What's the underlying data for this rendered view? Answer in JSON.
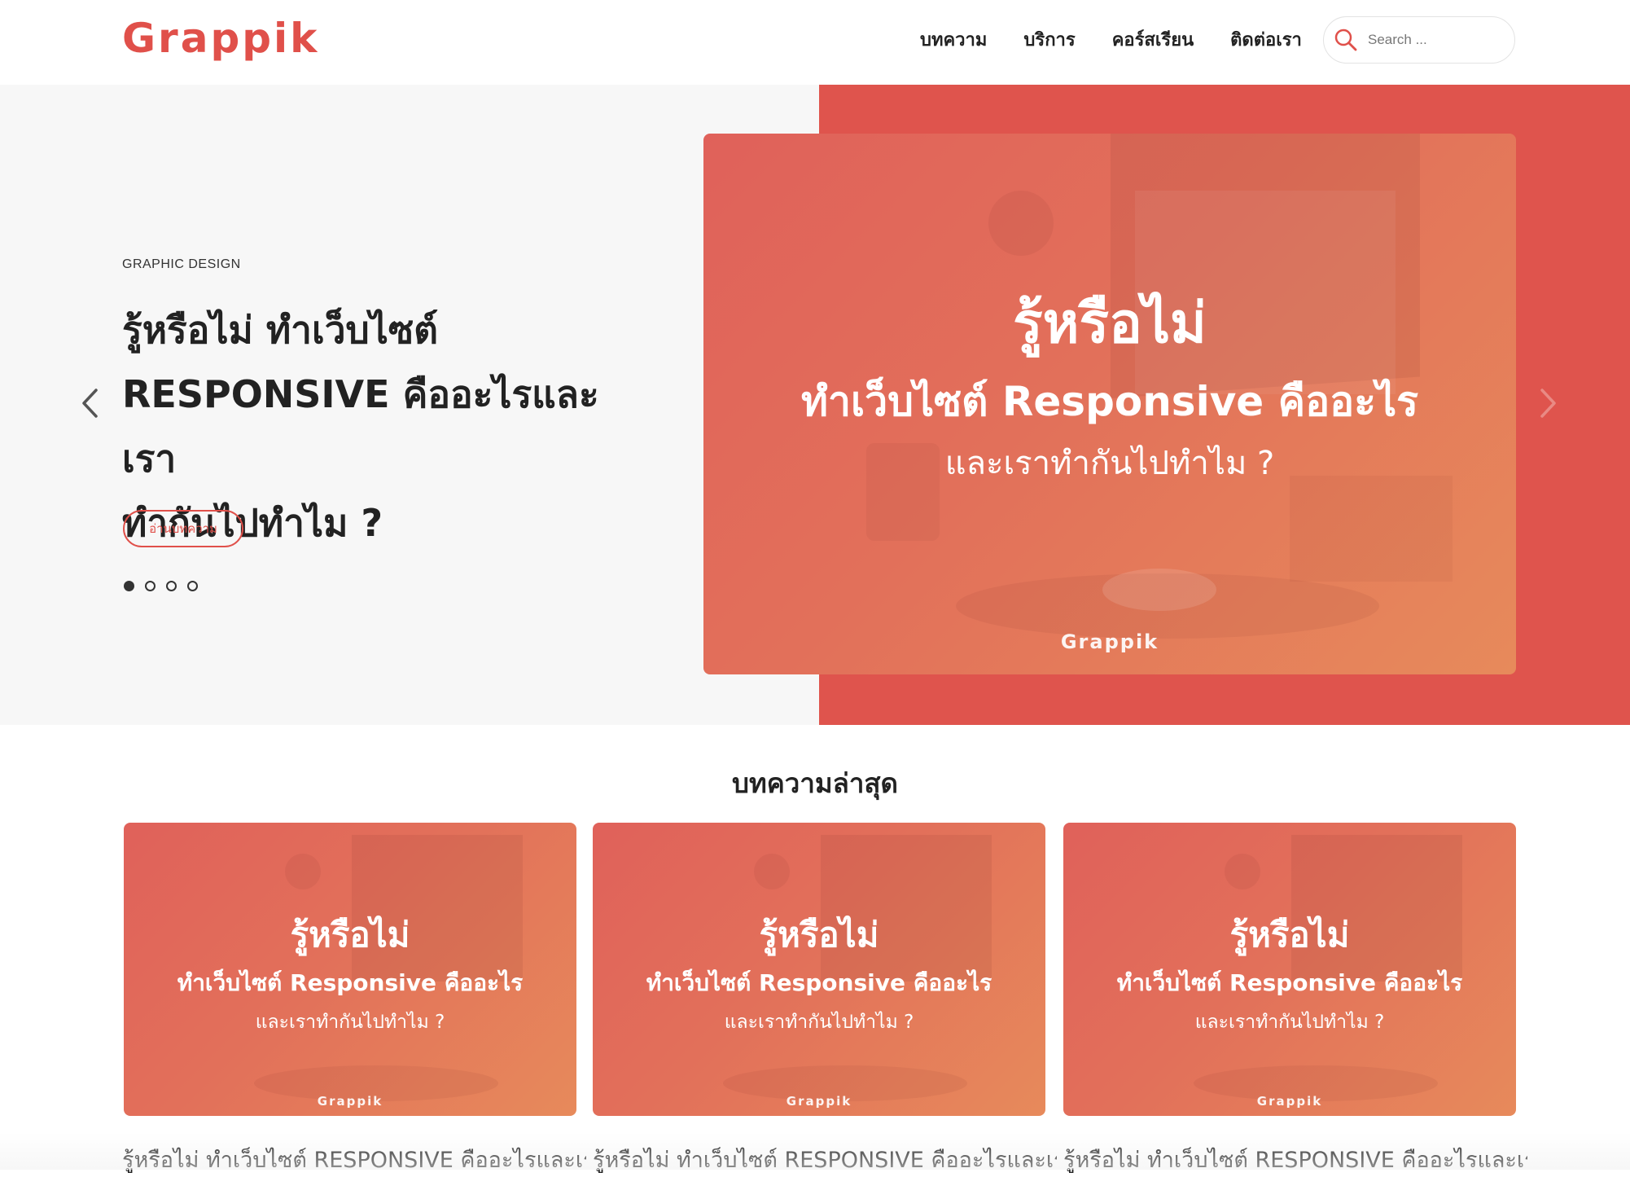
{
  "header": {
    "logo": "Grappik",
    "nav": [
      "บทความ",
      "บริการ",
      "คอร์สเรียน",
      "ติดต่อเรา"
    ],
    "search_placeholder": "Search ..."
  },
  "hero": {
    "category": "GRAPHIC DESIGN",
    "title_lines": [
      "รู้หรือไม่ ทำเว็บไซต์",
      "RESPONSIVE คืออะไรและเรา",
      "ทำกันไปทำไม ?"
    ],
    "button_label": "อ่านบทความ",
    "slide_count": 4,
    "active_slide": 1,
    "banner": {
      "line1": "รู้หรือไม่",
      "line2": "ทำเว็บไซต์ Responsive คืออะไร",
      "line3": "และเราทำกันไปทำไม ?",
      "brand": "Grappik"
    }
  },
  "latest": {
    "title": "บทความล่าสุด",
    "cards": [
      {
        "line1": "รู้หรือไม่",
        "line2": "ทำเว็บไซต์ Responsive คืออะไร",
        "line3": "และเราทำกันไปทำไม ?",
        "brand": "Grappik",
        "caption": "รู้หรือไม่ ทำเว็บไซต์ RESPONSIVE คืออะไรและเรา"
      },
      {
        "line1": "รู้หรือไม่",
        "line2": "ทำเว็บไซต์ Responsive คืออะไร",
        "line3": "และเราทำกันไปทำไม ?",
        "brand": "Grappik",
        "caption": "รู้หรือไม่ ทำเว็บไซต์ RESPONSIVE คืออะไรและเรา"
      },
      {
        "line1": "รู้หรือไม่",
        "line2": "ทำเว็บไซต์ Responsive คืออะไร",
        "line3": "และเราทำกันไปทำไม ?",
        "brand": "Grappik",
        "caption": "รู้หรือไม่ ทำเว็บไซต์ RESPONSIVE คืออะไรและเรา"
      }
    ]
  },
  "colors": {
    "accent": "#e0504a",
    "hero_panel": "#df544d",
    "hero_background": "#f7f7f7"
  },
  "icons": {
    "search": "search-icon",
    "prev": "chevron-left-icon",
    "next": "chevron-right-icon"
  }
}
